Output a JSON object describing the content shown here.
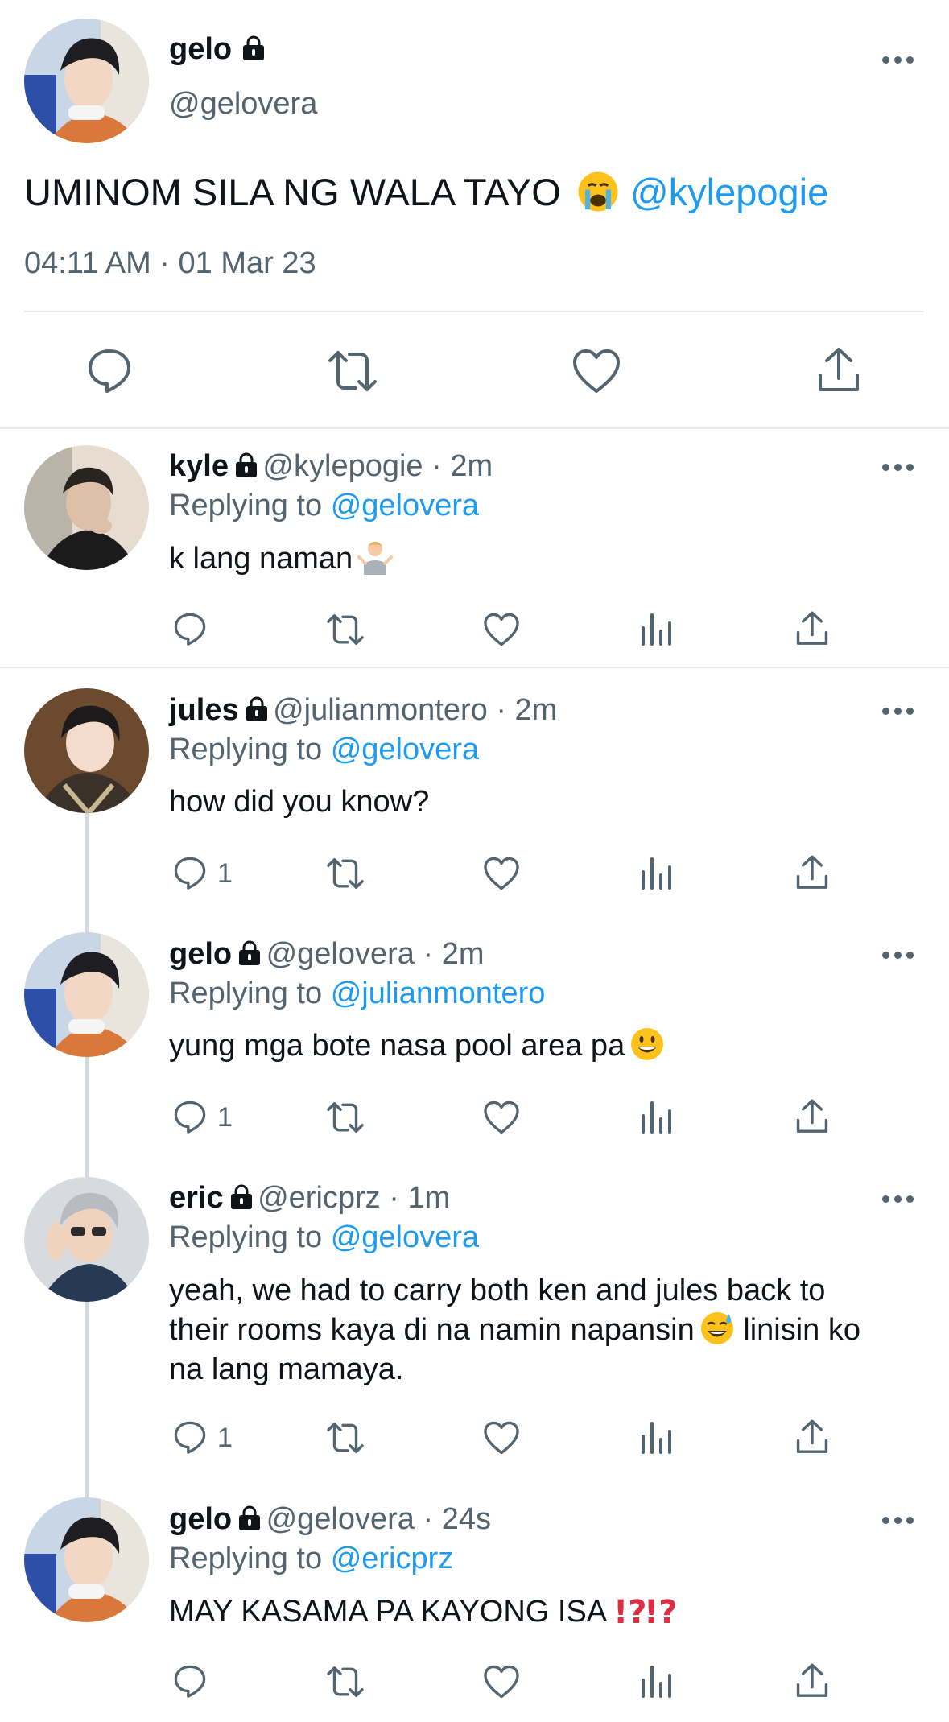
{
  "main_tweet": {
    "name": "gelo",
    "handle": "@gelovera",
    "text": "UMINOM SILA NG WALA TAYO",
    "mention": "@kylepogie",
    "timestamp": "04:11 AM · 01 Mar 23"
  },
  "replies": [
    {
      "name": "kyle",
      "handle_time": "@kylepogie · 2m",
      "replying_prefix": "Replying to",
      "replying_to": "@gelovera",
      "text_lines": [
        "k lang naman"
      ],
      "reply_count": ""
    },
    {
      "name": "jules",
      "handle_time": "@julianmontero · 2m",
      "replying_prefix": "Replying to",
      "replying_to": "@gelovera",
      "text_lines": [
        "how did you know?"
      ],
      "reply_count": "1"
    },
    {
      "name": "gelo",
      "handle_time": "@gelovera · 2m",
      "replying_prefix": "Replying to",
      "replying_to": "@julianmontero",
      "text_lines": [
        "yung mga bote nasa pool area pa"
      ],
      "reply_count": "1"
    },
    {
      "name": "eric",
      "handle_time": "@ericprz · 1m",
      "replying_prefix": "Replying to",
      "replying_to": "@gelovera",
      "text_lines": [
        "yeah, we had to carry both ken and jules back to",
        "their rooms kaya di na namin napansin",
        "linisin ko",
        "na lang mamaya."
      ],
      "reply_count": "1"
    },
    {
      "name": "gelo",
      "handle_time": "@gelovera · 24s",
      "replying_prefix": "Replying to",
      "replying_to": "@ericprz",
      "text_lines": [
        "MAY KASAMA PA KAYONG ISA"
      ],
      "reply_count": ""
    }
  ],
  "icons": {
    "reply": "reply-icon",
    "retweet": "retweet-icon",
    "like": "heart-icon",
    "views": "views-icon",
    "share": "share-icon",
    "more": "more-icon",
    "protected": "lock-icon"
  },
  "colors": {
    "link": "#1d9bf0",
    "secondary_text": "#536471",
    "primary_text": "#0f1419"
  }
}
